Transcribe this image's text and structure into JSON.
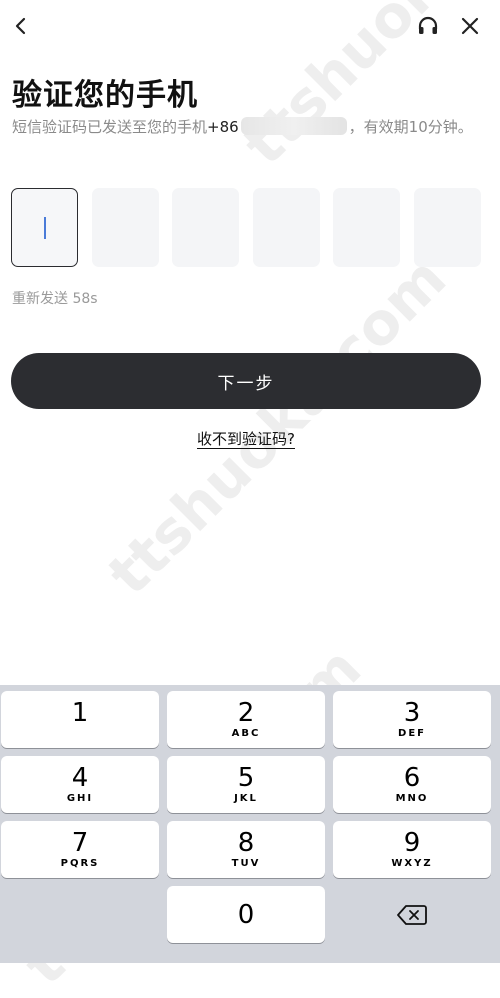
{
  "header": {
    "back_icon": "chevron-left-icon",
    "support_icon": "headset-icon",
    "close_icon": "close-icon"
  },
  "title": "验证您的手机",
  "subtitle": {
    "prefix": "短信验证码已发送至您的手机",
    "country_code": "+86",
    "suffix": "，有效期10分钟。"
  },
  "code_input": {
    "length": 6,
    "digits": [
      "",
      "",
      "",
      "",
      "",
      ""
    ],
    "active_index": 0
  },
  "resend_text": "重新发送 58s",
  "next_button": "下一步",
  "no_code_link": "收不到验证码?",
  "keyboard": {
    "keys": [
      {
        "num": "1",
        "letters": ""
      },
      {
        "num": "2",
        "letters": "ABC"
      },
      {
        "num": "3",
        "letters": "DEF"
      },
      {
        "num": "4",
        "letters": "GHI"
      },
      {
        "num": "5",
        "letters": "JKL"
      },
      {
        "num": "6",
        "letters": "MNO"
      },
      {
        "num": "7",
        "letters": "PQRS"
      },
      {
        "num": "8",
        "letters": "TUV"
      },
      {
        "num": "9",
        "letters": "WXYZ"
      },
      {
        "num": "0",
        "letters": ""
      }
    ],
    "delete_icon": "backspace-icon"
  },
  "watermark": "ttshuoka.com",
  "colors": {
    "primary_button": "#2c2d31",
    "caret": "#4a7bd8",
    "keyboard_bg": "#d2d5dc"
  }
}
